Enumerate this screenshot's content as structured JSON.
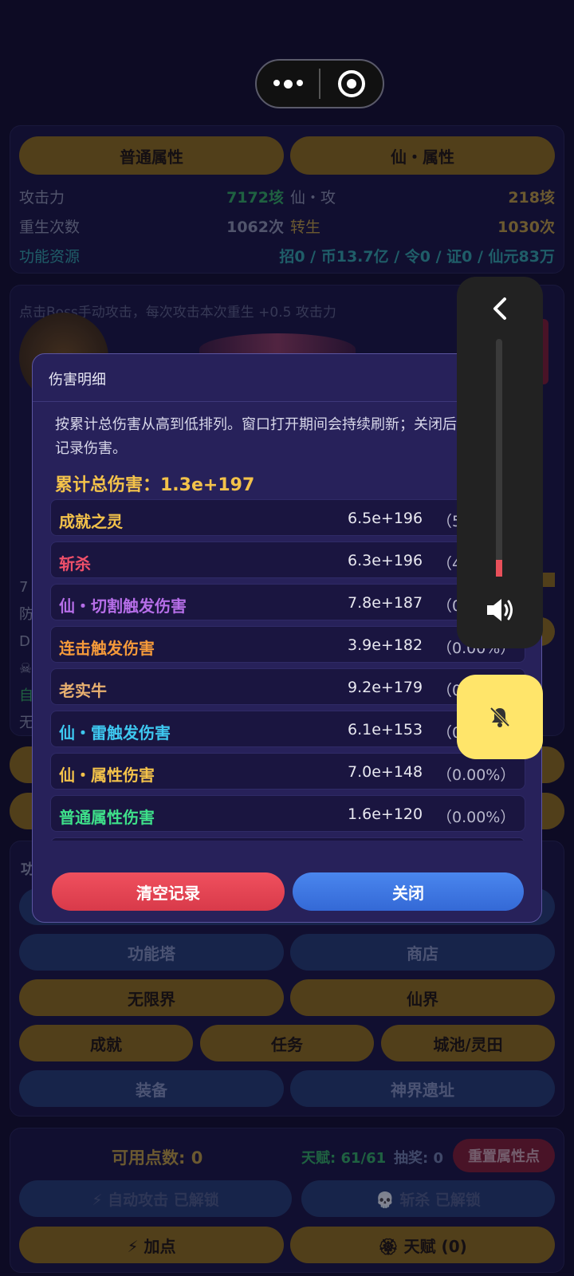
{
  "attr_tabs": {
    "normal": "普通属性",
    "immortal": "仙・属性"
  },
  "stats": {
    "attack_label": "攻击力",
    "attack_value": "7172垓",
    "imm_attack_label": "仙・攻",
    "imm_attack_value": "218垓",
    "rebirth_label": "重生次数",
    "rebirth_value": "1062次",
    "reincarnate_label": "转生",
    "reincarnate_value": "1030次",
    "resource_label": "功能资源",
    "resource_value": "招0 / 币13.7亿 / 令0 / 证0 / 仙元83万"
  },
  "hint_text": "点击Boss手动攻击，每次攻击本次重生 +0.5 攻击力",
  "bg_side_letters": [
    "7",
    "防",
    "D",
    "☠",
    "自",
    "无"
  ],
  "bg_section_letter": "功",
  "menu": {
    "tower": "功能塔",
    "shop": "商店",
    "infinite": "无限界",
    "immortal_realm": "仙界",
    "achievement": "成就",
    "task": "任务",
    "city": "城池/灵田",
    "equipment": "装备",
    "relic": "神界遗址"
  },
  "bottom": {
    "points_label": "可用点数: 0",
    "talent_label": "天赋: 61/61",
    "lottery_label": "抽奖: 0",
    "reset_button": "重置属性点",
    "auto_attack": "⚡ 自动攻击 已解锁",
    "slay": "💀 斩杀 已解锁",
    "add_points": "⚡ 加点",
    "talent_button": "🏵 天赋 (0)"
  },
  "modal": {
    "title": "伤害明细",
    "description": "按累计总伤害从高到低排列。窗口打开期间会持续刷新；关闭后仍会继续记录伤害。",
    "total_label": "累计总伤害：1.3e+197",
    "rows": [
      {
        "name": "成就之灵",
        "value": "6.5e+196",
        "pct": "（51.00%）",
        "color": "#f3c24a"
      },
      {
        "name": "斩杀",
        "value": "6.3e+196",
        "pct": "（48.99%）",
        "color": "#f0506a"
      },
      {
        "name": "仙・切割触发伤害",
        "value": "7.8e+187",
        "pct": "（0.00%）",
        "color": "#b66ee8"
      },
      {
        "name": "连击触发伤害",
        "value": "3.9e+182",
        "pct": "（0.00%）",
        "color": "#f59a3a"
      },
      {
        "name": "老实牛",
        "value": "9.2e+179",
        "pct": "（0.00%）",
        "color": "#e8b070"
      },
      {
        "name": "仙・雷触发伤害",
        "value": "6.1e+153",
        "pct": "（0.00%）",
        "color": "#3ec8f0"
      },
      {
        "name": "仙・属性伤害",
        "value": "7.0e+148",
        "pct": "（0.00%）",
        "color": "#f3c24a"
      },
      {
        "name": "普通属性伤害",
        "value": "1.6e+120",
        "pct": "（0.00%）",
        "color": "#3ee08a"
      },
      {
        "name": "",
        "value": "",
        "pct": "",
        "color": "#8888aa"
      }
    ],
    "clear_button": "清空记录",
    "close_button": "关闭"
  },
  "volume": {
    "level": 0.07
  },
  "icons": [
    "more-dots-icon",
    "target-icon",
    "chevron-left-icon",
    "speaker-icon",
    "bell-muted-icon"
  ]
}
